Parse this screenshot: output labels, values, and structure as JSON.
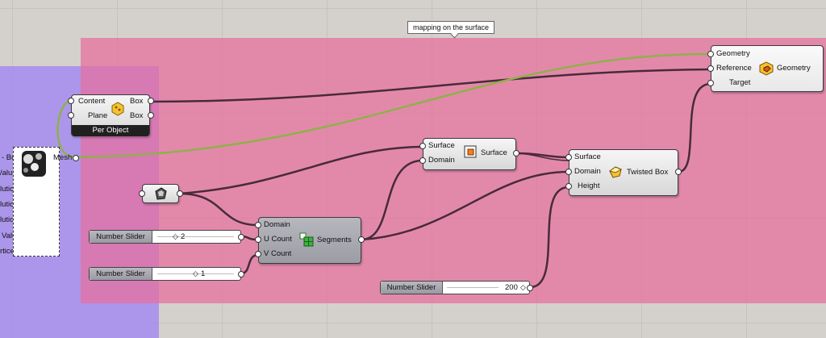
{
  "group": {
    "label": "mapping on the surface"
  },
  "per_object": {
    "inputs": [
      "Content",
      "Plane"
    ],
    "outputs": [
      "Box",
      "Box"
    ],
    "footer": "Per Object",
    "icon": "box-per-object-icon"
  },
  "mesh_panel": {
    "output": "Mesh",
    "truncated_labels": [
      "- Box",
      "/alues",
      "lution",
      "lution",
      "lution",
      "Value",
      "rtices"
    ]
  },
  "geometry_param": {
    "icon": "geometry-param-icon"
  },
  "surface_param": {
    "inputs": [
      "Surface",
      "Domain"
    ],
    "output": "Surface",
    "icon": "surface-icon"
  },
  "segments": {
    "inputs": [
      "Domain",
      "U Count",
      "V Count"
    ],
    "output": "Segments",
    "icon": "segments-icon"
  },
  "twisted_box": {
    "inputs": [
      "Surface",
      "Domain",
      "Height"
    ],
    "output": "Twisted Box",
    "icon": "twisted-box-icon"
  },
  "morph": {
    "inputs": [
      "Geometry",
      "Reference",
      "Target"
    ],
    "output": "Geometry",
    "icon": "box-morph-icon"
  },
  "sliders": [
    {
      "label": "Number Slider",
      "value": "2"
    },
    {
      "label": "Number Slider",
      "value": "1"
    },
    {
      "label": "Number Slider",
      "value": "200"
    }
  ],
  "colors": {
    "pink_group": "#e86e9c",
    "purple_group": "#a58cf0",
    "wire": "#4a2a3a",
    "wire_selected": "#8fb04a"
  }
}
